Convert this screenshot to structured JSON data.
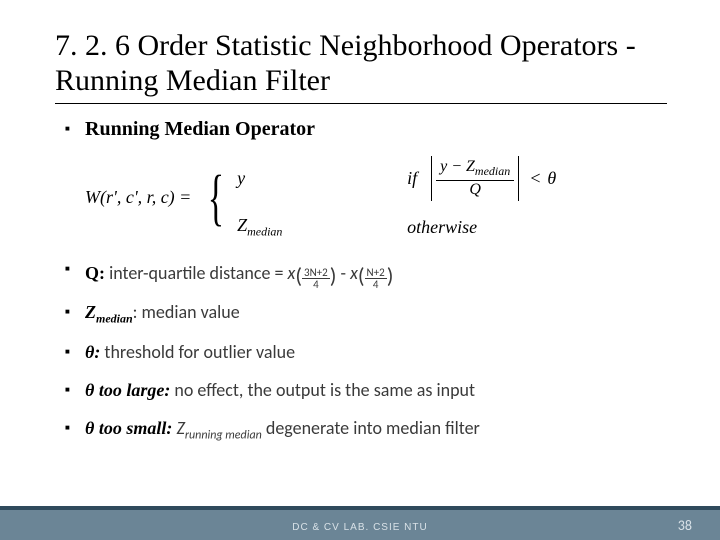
{
  "title": "7. 2. 6 Order Statistic Neighborhood Operators - Running Median Filter",
  "heading": "Running Median Operator",
  "formula": {
    "lhs": "W(r', c', r, c) =",
    "case1_val": "y",
    "case1_if": "if",
    "case1_frac_num": "y − Z",
    "case1_frac_num_sub": "median",
    "case1_frac_den": "Q",
    "case1_lt": "<",
    "case1_theta": "θ",
    "case2_val": "Z",
    "case2_val_sub": "median",
    "case2_cond": "otherwise"
  },
  "lines": {
    "q_label": "Q:",
    "q_text1": " inter-quartile distance = ",
    "q_x": "x",
    "q_sub1_num": "3N+2",
    "q_sub1_den": "4",
    "q_minus": " - ",
    "q_sub2_num": "N+2",
    "q_sub2_den": "4",
    "zmed_label": "Z",
    "zmed_sub": "median",
    "zmed_text": ": median value",
    "theta_label": "θ:",
    "theta_text": " threshold for outlier value",
    "large_label": "θ too large:",
    "large_text": " no effect, the output is the same as input",
    "small_label": "θ too small:",
    "small_z": " Z",
    "small_sub": "running median",
    "small_text": " degenerate into median filter"
  },
  "footer": {
    "text": "DC & CV LAB. CSIE NTU",
    "page": "38"
  }
}
